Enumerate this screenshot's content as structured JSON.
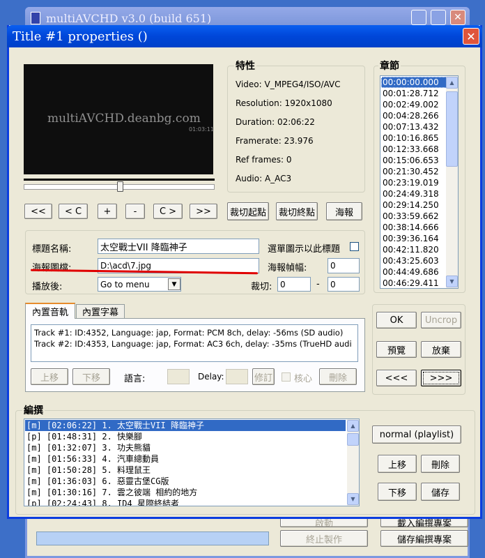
{
  "bg_window": {
    "title": "multiAVCHD v3.0 (build 651)",
    "btn_bottom_left": "終止製作",
    "btn_bottom_right": "儲存編撰專案",
    "btn_upper_left": "啟動",
    "btn_upper_right": "載入編撰專案"
  },
  "dialog": {
    "title": "Title #1 properties ()"
  },
  "preview": {
    "watermark": "multiAVCHD.deanbg.com",
    "timecode": "01:03:11"
  },
  "properties": {
    "heading": "特性",
    "lines": [
      "Video: V_MPEG4/ISO/AVC",
      "Resolution: 1920x1080",
      "Duration: 02:06:22",
      "Framerate: 23.976",
      "Ref frames: 0",
      "Audio: A_AC3"
    ]
  },
  "chapters": {
    "heading": "章節",
    "items": [
      "00:00:00.000",
      "00:01:28.712",
      "00:02:49.002",
      "00:04:28.266",
      "00:07:13.432",
      "00:10:16.865",
      "00:12:33.668",
      "00:15:06.653",
      "00:21:30.452",
      "00:23:19.019",
      "00:24:49.318",
      "00:29:14.250",
      "00:33:59.662",
      "00:38:14.666",
      "00:39:36.164",
      "00:42:11.820",
      "00:43:25.603",
      "00:44:49.686",
      "00:46:29.411"
    ]
  },
  "transport": [
    "<<",
    "< C",
    "+",
    "-",
    "C >",
    ">>"
  ],
  "cut_start": "裁切起點",
  "cut_end": "裁切終點",
  "poster_btn": "海報",
  "form": {
    "title_label": "標題名稱:",
    "title_value": "太空戰士VII 降臨神子",
    "menu_check": "選單圖示以此標題",
    "poster_label": "海報圖檔:",
    "poster_value": "D:\\acd\\7.jpg",
    "poster_frame_label": "海報幀幅:",
    "poster_frame_value": "0",
    "after_label": "播放後:",
    "after_value": "Go to menu",
    "crop_label": "裁切:",
    "crop_a": "0",
    "crop_sep": "-",
    "crop_b": "0"
  },
  "tabs": [
    "內置音軌",
    "內置字幕"
  ],
  "tracks": [
    "Track #1: ID:4352, Language: jap, Format: PCM 8ch, delay: -56ms (SD audio)",
    "Track #2: ID:4353, Language: jap, Format: AC3 6ch, delay: -35ms (TrueHD audi"
  ],
  "track_ctrl": {
    "up": "上移",
    "down": "下移",
    "lang": "語言:",
    "delay": "Delay:",
    "modify": "修訂",
    "verify": "核心",
    "delete": "刪除"
  },
  "right_btns": {
    "ok": "OK",
    "uncrop": "Uncrop",
    "preview": "預覽",
    "discard": "放棄",
    "prev": "<<<",
    "next": ">>>"
  },
  "edit": {
    "heading": "編撰",
    "items": [
      "[m] [02:06:22] 1. 太空戰士VII 降臨神子",
      "[p] [01:48:31] 2. 快樂腳",
      "[m] [01:32:07] 3. 功夫熊貓",
      "[m] [01:56:33] 4. 汽車總動員",
      "[m] [01:50:28] 5. 料理鼠王",
      "[m] [01:36:03] 6. 惡靈古堡CG版",
      "[m] [01:30:16] 7. 雲之彼端 相約的地方",
      "[p] [02:24:43] 8. ID4 星際終結者"
    ],
    "btn_playlist": "normal (playlist)",
    "btn_up": "上移",
    "btn_delete": "刪除",
    "btn_down": "下移",
    "btn_save": "儲存"
  },
  "colors": {
    "xp_blue": "#0a246a",
    "dialog_face": "#ece9d8",
    "selection": "#316ac5",
    "annotation": "#e00000"
  }
}
